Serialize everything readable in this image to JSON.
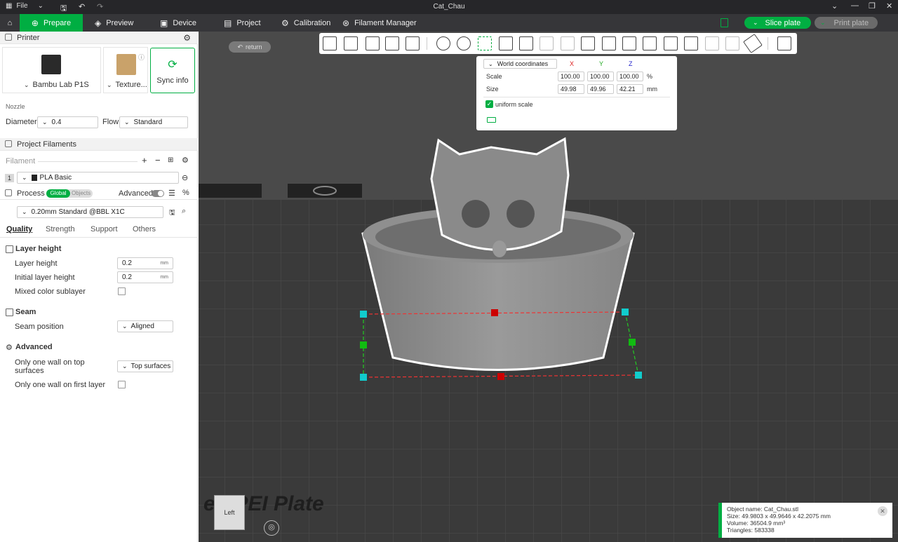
{
  "title_bar": {
    "file_menu": "File",
    "window_title": "Cat_Chau"
  },
  "tabs": [
    {
      "label": "Prepare"
    },
    {
      "label": "Preview"
    },
    {
      "label": "Device"
    },
    {
      "label": "Project"
    },
    {
      "label": "Calibration"
    },
    {
      "label": "Filament Manager"
    }
  ],
  "actions": {
    "slice": "Slice plate",
    "print": "Print plate"
  },
  "printer": {
    "title": "Printer",
    "name": "Bambu Lab P1S",
    "plate": "Texture...",
    "sync": "Sync info",
    "nozzle_label": "Nozzle",
    "diameter_label": "Diameter",
    "diameter": "0.4",
    "flow_label": "Flow",
    "flow": "Standard"
  },
  "filaments": {
    "title": "Project Filaments",
    "filament_label": "Filament",
    "slot": "1",
    "name": "PLA Basic"
  },
  "process": {
    "title": "Process",
    "global": "Global",
    "objects": "Objects",
    "advanced": "Advanced",
    "preset": "0.20mm Standard @BBL X1C",
    "tabs": [
      "Quality",
      "Strength",
      "Support",
      "Others"
    ]
  },
  "settings": {
    "layer_height_group": "Layer height",
    "layer_height_label": "Layer height",
    "layer_height": "0.2",
    "initial_layer_label": "Initial layer height",
    "initial_layer": "0.2",
    "unit": "mm",
    "mixed_label": "Mixed color sublayer",
    "seam_group": "Seam",
    "seam_pos_label": "Seam position",
    "seam_pos": "Aligned",
    "advanced_group": "Advanced",
    "one_wall_top_label": "Only one wall on top surfaces",
    "one_wall_top": "Top surfaces",
    "one_wall_first_label": "Only one wall on first layer"
  },
  "viewport": {
    "return": "return",
    "plate_text": "ed PEI Plate",
    "view_cube": "Left"
  },
  "scale_panel": {
    "coords": "World coordinates",
    "x": "X",
    "y": "Y",
    "z": "Z",
    "scale_label": "Scale",
    "scale": [
      "100.00",
      "100.00",
      "100.00"
    ],
    "scale_unit": "%",
    "size_label": "Size",
    "size": [
      "49.98",
      "49.96",
      "42.21"
    ],
    "size_unit": "mm",
    "uniform": "uniform scale"
  },
  "object_info": {
    "name": "Object name: Cat_Chau.stl",
    "size": "Size: 49.9803 x 49.9646 x 42.2075 mm",
    "volume": "Volume: 36504.9 mm³",
    "triangles": "Triangles: 583338"
  },
  "colors": {
    "accent": "#00ae42",
    "bed": "#3d3d3d",
    "model": "#8c8c8c"
  }
}
